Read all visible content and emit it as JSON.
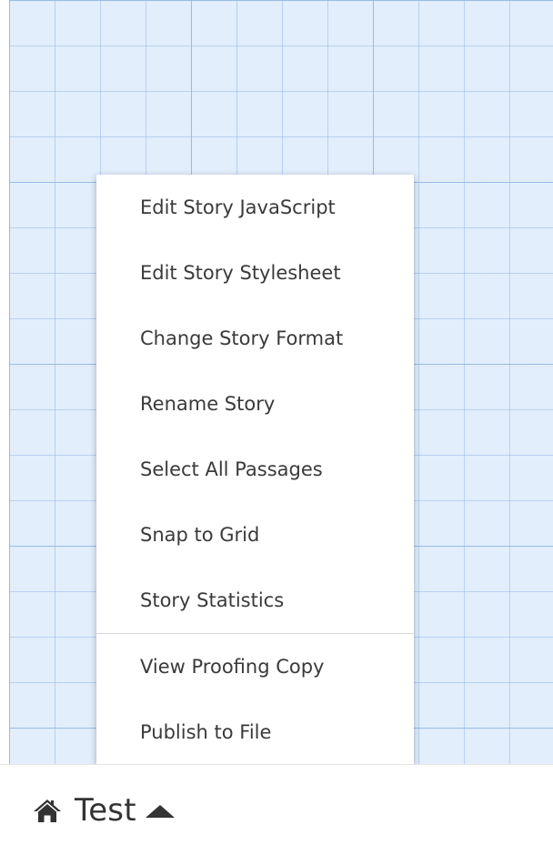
{
  "menu": {
    "group1": [
      {
        "label": "Edit Story JavaScript"
      },
      {
        "label": "Edit Story Stylesheet"
      },
      {
        "label": "Change Story Format"
      },
      {
        "label": "Rename Story"
      },
      {
        "label": "Select All Passages"
      },
      {
        "label": "Snap to Grid"
      },
      {
        "label": "Story Statistics"
      }
    ],
    "group2": [
      {
        "label": "View Proofing Copy"
      },
      {
        "label": "Publish to File"
      }
    ]
  },
  "bottom_bar": {
    "story_name": "Test",
    "home_icon": "home-icon",
    "caret_icon": "caret-up-icon"
  },
  "colors": {
    "canvas": "#e2eefc",
    "grid_line": "#96b9e6",
    "menu_bg": "#ffffff",
    "text": "#3a3a3a"
  }
}
